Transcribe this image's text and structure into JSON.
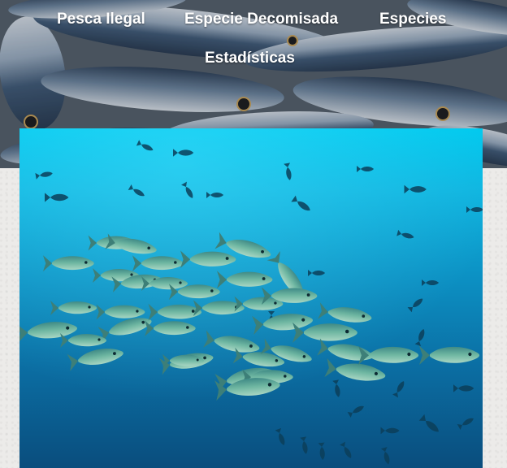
{
  "nav": {
    "items": [
      {
        "label": "Pesca Ilegal"
      },
      {
        "label": "Especie Decomisada"
      },
      {
        "label": "Especies"
      },
      {
        "label": "Estadísticas"
      }
    ]
  },
  "images": {
    "hero": "sardines-pile-photo",
    "feature": "underwater-fish-school-photo"
  },
  "colors": {
    "nav_text": "#ffffff",
    "page_background": "#ecebe9",
    "water_top": "#00c9ee",
    "water_bottom": "#0a4d7d"
  }
}
